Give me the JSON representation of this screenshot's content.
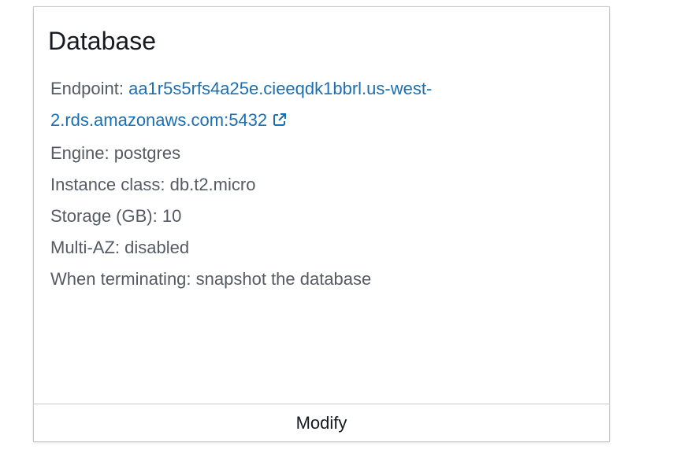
{
  "card": {
    "title": "Database",
    "endpoint": {
      "label": "Endpoint: ",
      "line1": "aa1r5s5rfs4a25e.cieeqdk1bbrl.us-west-",
      "line2": "2.rds.amazonaws.com:5432",
      "icon": "external-link-icon"
    },
    "fields": [
      {
        "text": "Engine: postgres"
      },
      {
        "text": "Instance class: db.t2.micro"
      },
      {
        "text": "Storage (GB): 10"
      },
      {
        "text": "Multi-AZ: disabled"
      },
      {
        "text": "When terminating: snapshot the database"
      }
    ],
    "footer": {
      "button_label": "Modify"
    }
  },
  "colors": {
    "link": "#1c6fb1",
    "text": "#545b64",
    "title": "#16191f",
    "border": "#c8c8c8"
  }
}
